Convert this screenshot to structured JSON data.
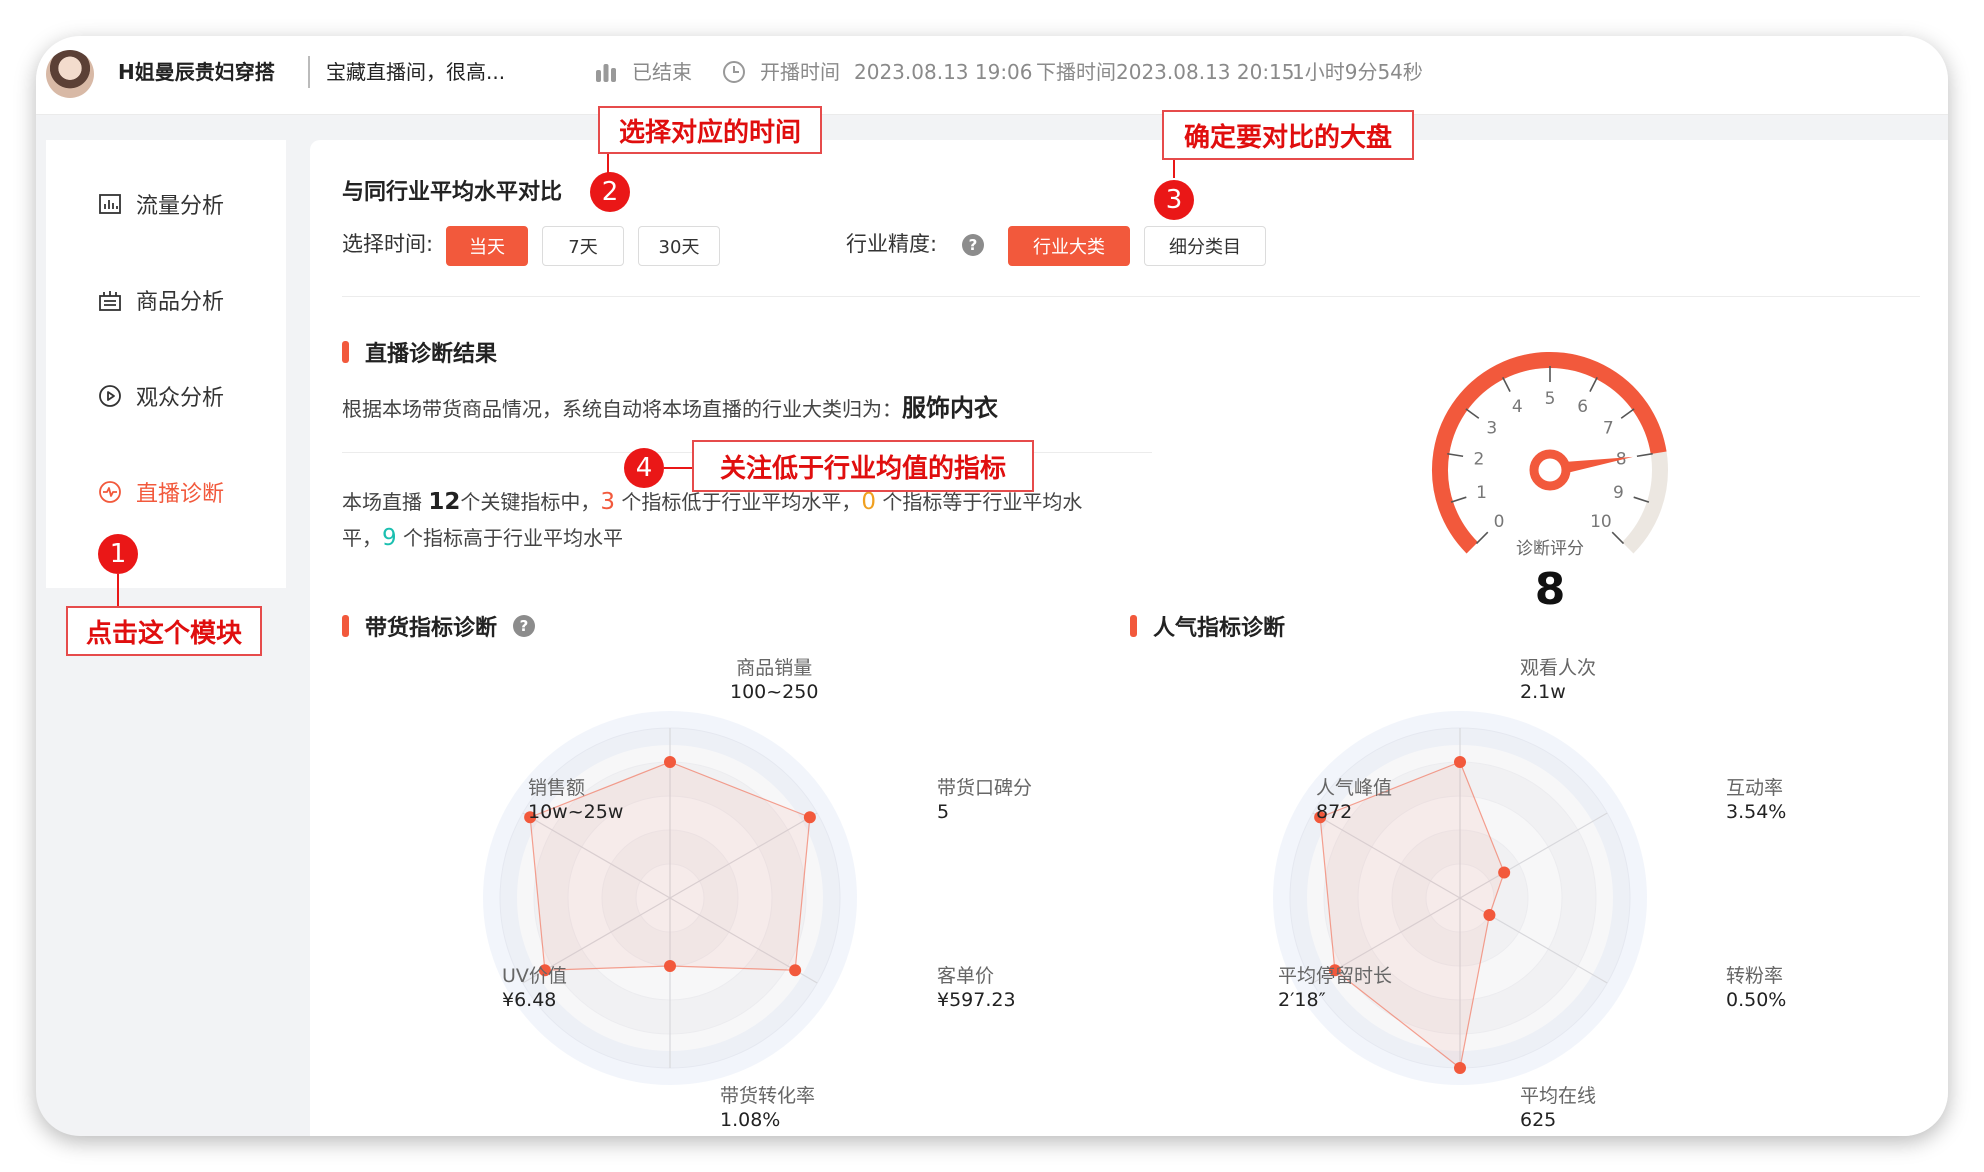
{
  "header": {
    "anchor_name": "H姐曼辰贵妇穿搭",
    "stream_title": "宝藏直播间，很高...",
    "status": "已结束",
    "start_label": "开播时间",
    "start_time": "2023.08.13 19:06",
    "end_label": "下播时间",
    "end_time": "2023.08.13 20:15",
    "duration": "1小时9分54秒"
  },
  "sidebar": {
    "items": [
      {
        "label": "流量分析",
        "icon": "bar-chart-icon"
      },
      {
        "label": "商品分析",
        "icon": "shopping-icon"
      },
      {
        "label": "观众分析",
        "icon": "play-circle-icon"
      },
      {
        "label": "直播诊断",
        "icon": "pulse-icon",
        "active": true
      }
    ]
  },
  "compare": {
    "title": "与同行业平均水平对比",
    "time_label": "选择时间:",
    "time_options": [
      "当天",
      "7天",
      "30天"
    ],
    "time_selected": "当天",
    "precision_label": "行业精度:",
    "precision_options": [
      "行业大类",
      "细分类目"
    ],
    "precision_selected": "行业大类"
  },
  "diagnosis": {
    "title": "直播诊断结果",
    "desc_prefix": "根据本场带货商品情况，系统自动将本场直播的行业大类归为：",
    "category": "服饰内衣",
    "summary": {
      "p1": "本场直播 ",
      "total": "12",
      "p2": "个关键指标中，",
      "below": "3",
      "p3": " 个指标低于行业平均水平，",
      "equal": "0",
      "p4": " 个指标等于行业平均水",
      "p5": "平，",
      "above": "9",
      "p6": " 个指标高于行业平均水平"
    },
    "gauge": {
      "label": "诊断评分",
      "score": "8",
      "ticks": [
        "0",
        "1",
        "2",
        "3",
        "4",
        "5",
        "6",
        "7",
        "8",
        "9",
        "10"
      ],
      "min": 0,
      "max": 10,
      "value": 8
    }
  },
  "goods_radar": {
    "title": "带货指标诊断",
    "axes": [
      {
        "name": "商品销量",
        "value": "100~250"
      },
      {
        "name": "带货口碑分",
        "value": "5"
      },
      {
        "name": "客单价",
        "value": "¥597.23"
      },
      {
        "name": "带货转化率",
        "value": "1.08%"
      },
      {
        "name": "UV价值",
        "value": "¥6.48"
      },
      {
        "name": "销售额",
        "value": "10w~25w"
      }
    ],
    "levels": [
      0.8,
      0.95,
      0.85,
      0.4,
      0.85,
      0.95
    ]
  },
  "popularity_radar": {
    "title": "人气指标诊断",
    "axes": [
      {
        "name": "观看人次",
        "value": "2.1w"
      },
      {
        "name": "互动率",
        "value": "3.54%"
      },
      {
        "name": "转粉率",
        "value": "0.50%"
      },
      {
        "name": "平均在线",
        "value": "625"
      },
      {
        "name": "平均停留时长",
        "value": "2′18″"
      },
      {
        "name": "人气峰值",
        "value": "872"
      }
    ],
    "levels": [
      0.8,
      0.3,
      0.2,
      1.0,
      0.85,
      0.95
    ]
  },
  "annotations": [
    {
      "num": "1",
      "text": "点击这个模块"
    },
    {
      "num": "2",
      "text": "选择对应的时间"
    },
    {
      "num": "3",
      "text": "确定要对比的大盘"
    },
    {
      "num": "4",
      "text": "关注低于行业均值的指标"
    }
  ],
  "colors": {
    "accent": "#f2593c",
    "callout": "#ea1717",
    "equal": "#f0a020",
    "above": "#1bbfb0",
    "gauge_track": "#ece7e1"
  }
}
